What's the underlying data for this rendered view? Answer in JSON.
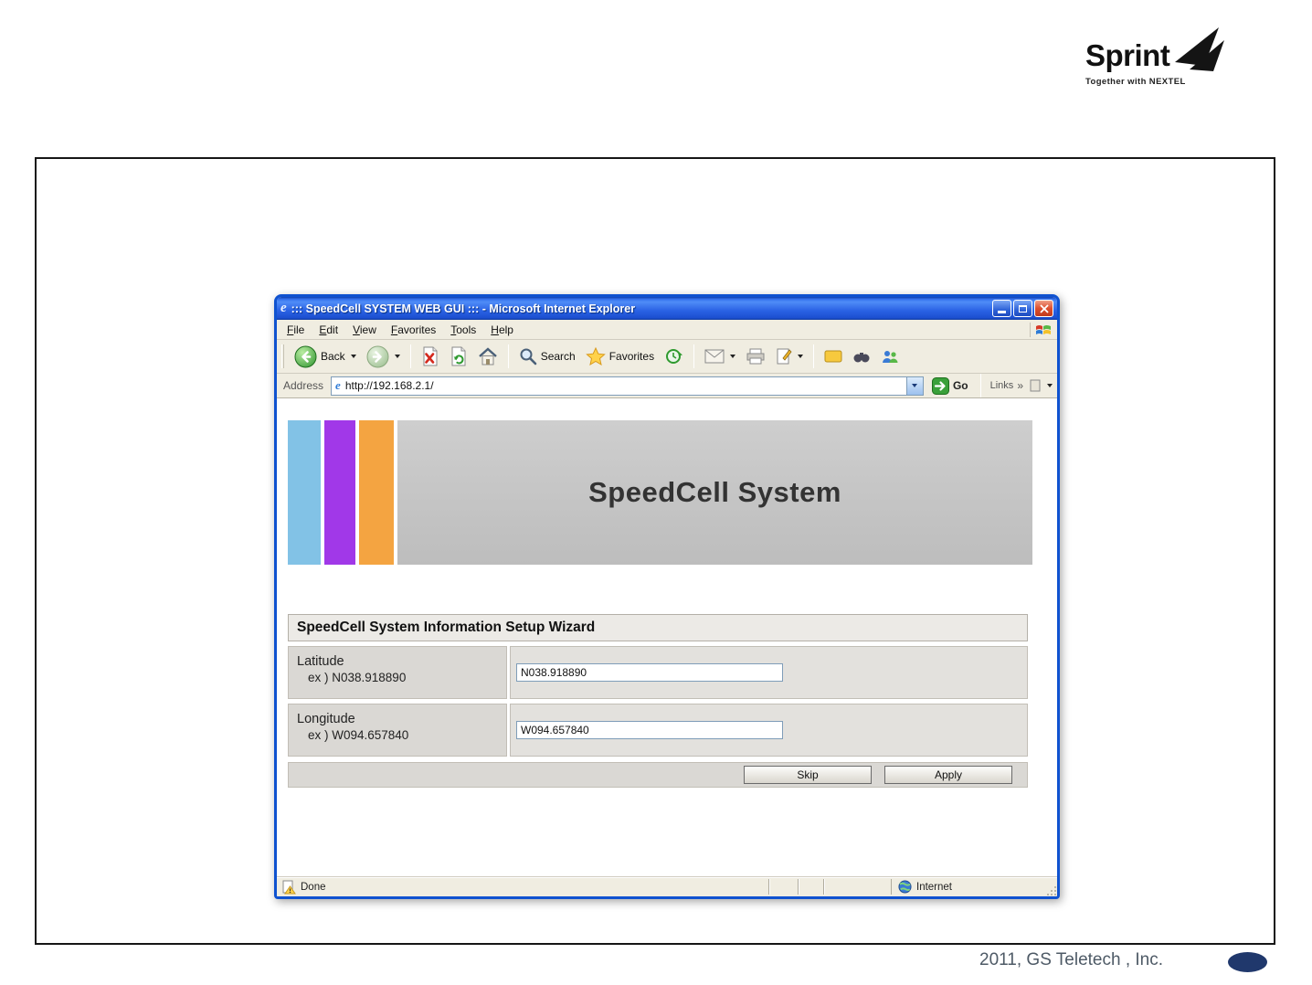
{
  "sprint": {
    "brand": "Sprint",
    "tagline": "Together with NEXTEL"
  },
  "footer": {
    "credit": "2011, GS Teletech , Inc."
  },
  "browser": {
    "title": "::: SpeedCell SYSTEM WEB GUI ::: - Microsoft Internet Explorer",
    "menus": [
      "File",
      "Edit",
      "View",
      "Favorites",
      "Tools",
      "Help"
    ],
    "toolbar": {
      "back": "Back",
      "search": "Search",
      "favorites": "Favorites"
    },
    "address": {
      "label": "Address",
      "url": "http://192.168.2.1/",
      "go": "Go",
      "links": "Links",
      "chevrons": "»"
    },
    "status": {
      "done": "Done",
      "zone": "Internet"
    }
  },
  "content": {
    "banner_title": "SpeedCell System",
    "wizard": {
      "title": "SpeedCell System Information Setup Wizard",
      "rows": [
        {
          "label": "Latitude",
          "example": "ex ) N038.918890",
          "value": "N038.918890"
        },
        {
          "label": "Longitude",
          "example": "ex ) W094.657840",
          "value": "W094.657840"
        }
      ],
      "buttons": {
        "skip": "Skip",
        "apply": "Apply"
      }
    }
  }
}
